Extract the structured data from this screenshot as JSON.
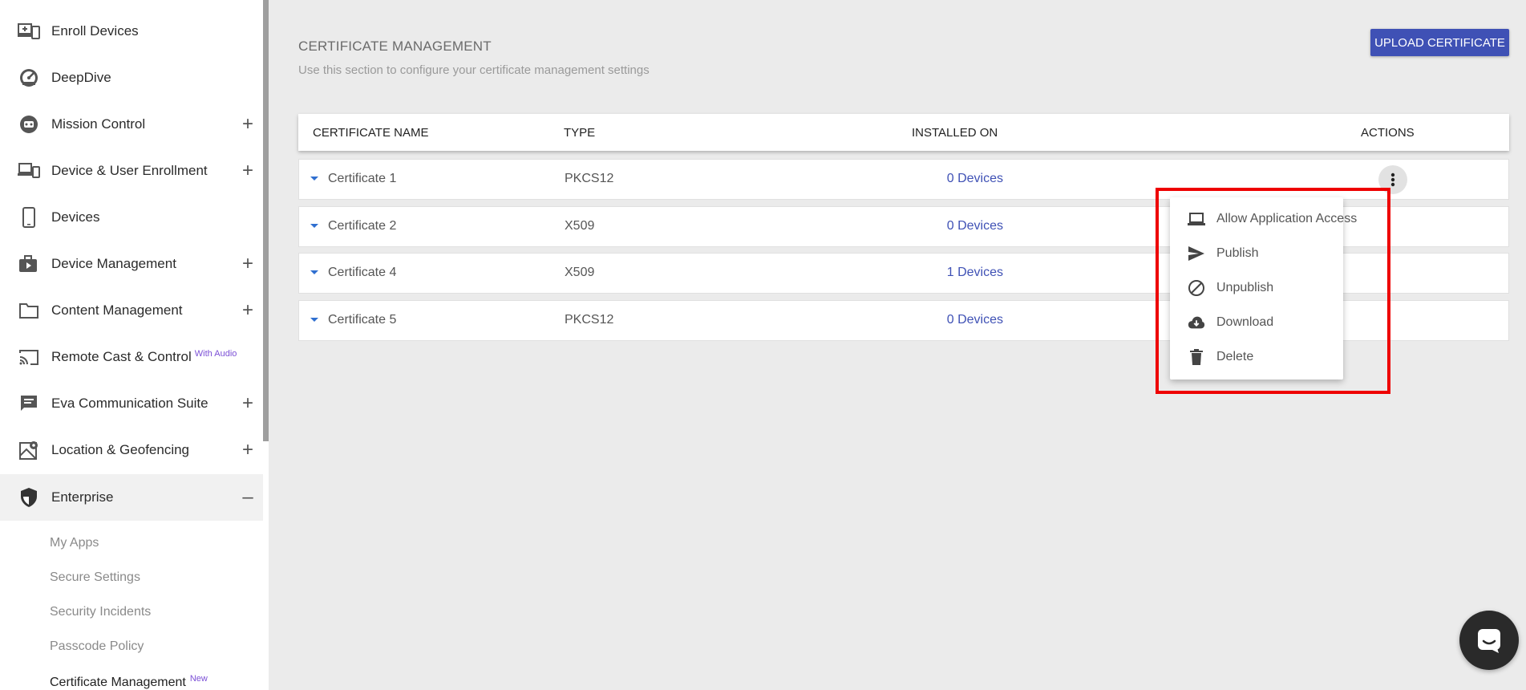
{
  "sidebar": {
    "items": [
      {
        "label": "Enroll Devices",
        "icon": "enroll-devices-icon",
        "expandable": false
      },
      {
        "label": "DeepDive",
        "icon": "speedometer-icon",
        "expandable": false
      },
      {
        "label": "Mission Control",
        "icon": "mission-control-icon",
        "expandable": true
      },
      {
        "label": "Device & User Enrollment",
        "icon": "devices-enroll-icon",
        "expandable": true
      },
      {
        "label": "Devices",
        "icon": "phone-icon",
        "expandable": false
      },
      {
        "label": "Device Management",
        "icon": "briefcase-icon",
        "expandable": true
      },
      {
        "label": "Content Management",
        "icon": "folder-icon",
        "expandable": true
      },
      {
        "label": "Remote Cast & Control",
        "badge": "With Audio",
        "icon": "cast-icon",
        "expandable": false
      },
      {
        "label": "Eva Communication Suite",
        "icon": "chat-icon",
        "expandable": true
      },
      {
        "label": "Location & Geofencing",
        "icon": "map-icon",
        "expandable": true
      },
      {
        "label": "Enterprise",
        "icon": "shield-icon",
        "expandable": true,
        "expanded": true
      }
    ],
    "expand_symbol": "+",
    "collapse_symbol": "–",
    "enterprise_subitems": [
      {
        "label": "My Apps"
      },
      {
        "label": "Secure Settings"
      },
      {
        "label": "Security Incidents"
      },
      {
        "label": "Passcode Policy"
      },
      {
        "label": "Certificate Management",
        "badge": "New",
        "current": true
      }
    ]
  },
  "header": {
    "title": "CERTIFICATE MANAGEMENT",
    "subtitle": "Use this section to configure your certificate management settings",
    "upload_button": "UPLOAD CERTIFICATE"
  },
  "table": {
    "columns": [
      "CERTIFICATE NAME",
      "TYPE",
      "INSTALLED ON",
      "ACTIONS"
    ],
    "rows": [
      {
        "name": "Certificate 1",
        "type": "PKCS12",
        "installed": "0 Devices"
      },
      {
        "name": "Certificate 2",
        "type": "X509",
        "installed": "0 Devices"
      },
      {
        "name": "Certificate 4",
        "type": "X509",
        "installed": "1 Devices"
      },
      {
        "name": "Certificate 5",
        "type": "PKCS12",
        "installed": "0 Devices"
      }
    ]
  },
  "actions_menu": {
    "items": [
      {
        "label": "Allow Application Access",
        "icon": "laptop-icon"
      },
      {
        "label": "Publish",
        "icon": "send-icon"
      },
      {
        "label": "Unpublish",
        "icon": "block-icon"
      },
      {
        "label": "Download",
        "icon": "cloud-download-icon"
      },
      {
        "label": "Delete",
        "icon": "trash-icon"
      }
    ]
  },
  "colors": {
    "primary": "#3f51b5",
    "highlight": "#ee0000",
    "badge": "#7b4fd6",
    "caret": "#2f6fd0"
  }
}
